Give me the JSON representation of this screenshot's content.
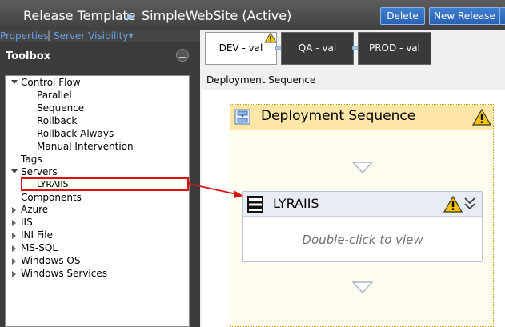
{
  "header": {
    "breadcrumb_root": "Release Template",
    "breadcrumb_current": "SimpleWebSite (Active)",
    "delete_label": "Delete",
    "new_release_label": "New Release"
  },
  "links": {
    "properties": "Properties",
    "separator": "|",
    "server_visibility": "Server Visibility"
  },
  "toolbox": {
    "title": "Toolbox",
    "items": [
      "Control Flow",
      "Parallel",
      "Sequence",
      "Rollback",
      "Rollback Always",
      "Manual Intervention",
      "Tags",
      "Servers",
      "LYRAIIS",
      "Components",
      "Azure",
      "IIS",
      "INI File",
      "MS-SQL",
      "Windows OS",
      "Windows Services"
    ]
  },
  "stages": [
    "DEV - val",
    "QA - val",
    "PROD - val"
  ],
  "sequence_tab_label": "Deployment Sequence",
  "sequence": {
    "title": "Deployment Sequence",
    "server": {
      "name": "LYRAIIS",
      "hint": "Double-click to view"
    }
  },
  "colors": {
    "accent_button": "#2d6bc0",
    "warning": "#f5c400",
    "selection_outline": "#e01010",
    "sequence_header": "#fde6a6"
  }
}
